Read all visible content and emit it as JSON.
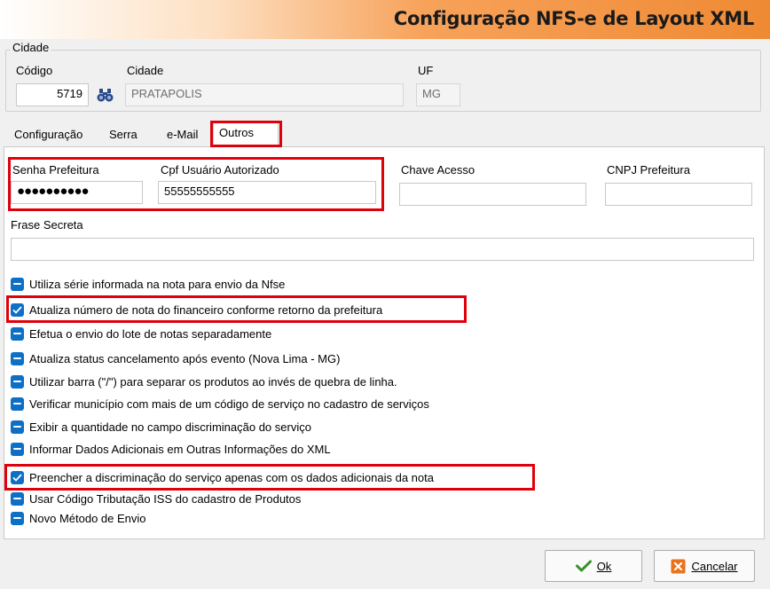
{
  "window": {
    "title": "Configuração NFS-e de Layout XML"
  },
  "cidade_group": {
    "legend": "Cidade",
    "codigo_label": "Código",
    "codigo_value": "5719",
    "cidade_label": "Cidade",
    "cidade_value": "PRATAPOLIS",
    "uf_label": "UF",
    "uf_value": "MG"
  },
  "tabs": [
    {
      "label": "Configuração",
      "active": false
    },
    {
      "label": "Serra",
      "active": false
    },
    {
      "label": "e-Mail",
      "active": false
    },
    {
      "label": "Outros",
      "active": true
    }
  ],
  "fields": {
    "senha_label": "Senha Prefeitura",
    "senha_value": "●●●●●●●●●●",
    "cpf_label": "Cpf Usuário Autorizado",
    "cpf_value": "55555555555",
    "chave_label": "Chave Acesso",
    "chave_value": "",
    "cnpj_label": "CNPJ Prefeitura",
    "cnpj_value": "",
    "frase_label": "Frase Secreta",
    "frase_value": ""
  },
  "options": [
    {
      "label": "Utiliza série informada na nota para envio da Nfse",
      "state": "indeterminate"
    },
    {
      "label": "Atualiza número de nota do financeiro conforme retorno da prefeitura",
      "state": "checked"
    },
    {
      "label": "Efetua o envio do lote de notas separadamente",
      "state": "indeterminate"
    },
    {
      "label": "Atualiza status cancelamento após evento (Nova Lima - MG)",
      "state": "indeterminate"
    },
    {
      "label": "Utilizar barra (\"/\") para separar os produtos ao invés de quebra de linha.",
      "state": "indeterminate"
    },
    {
      "label": "Verificar município com mais de um código de serviço no cadastro de serviços",
      "state": "indeterminate"
    },
    {
      "label": "Exibir a quantidade no campo discriminação do serviço",
      "state": "indeterminate"
    },
    {
      "label": "Informar Dados Adicionais em Outras Informações do  XML",
      "state": "indeterminate"
    },
    {
      "label": "Preencher a discriminação do serviço apenas com os dados adicionais da nota",
      "state": "checked"
    },
    {
      "label": "Usar Código Tributação ISS do cadastro de Produtos",
      "state": "indeterminate"
    },
    {
      "label": "Novo Método de Envio",
      "state": "indeterminate"
    }
  ],
  "buttons": {
    "ok_label": "Ok",
    "cancel_label": "Cancelar"
  },
  "colors": {
    "header_accent": "#ef8a33",
    "checkbox": "#0d6fc6",
    "highlight_box": "#e0000b",
    "ok_icon": "#3a8f2a",
    "cancel_icon": "#e8731c"
  }
}
